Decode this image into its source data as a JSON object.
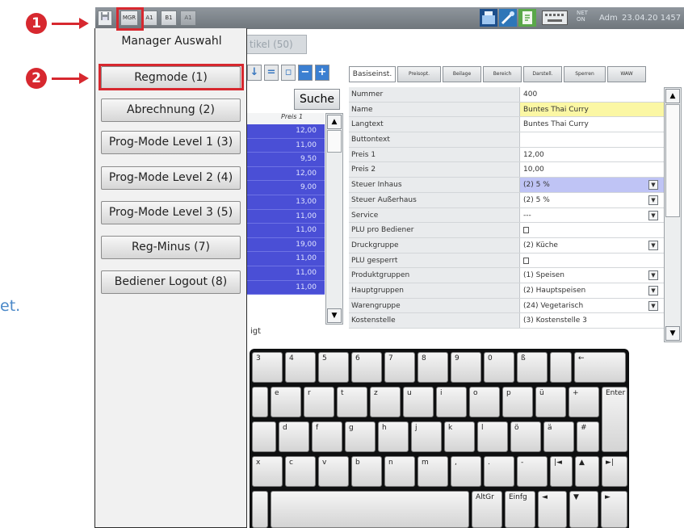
{
  "annotations": {
    "step1": "1",
    "step2": "2",
    "side_text_fragment": "et."
  },
  "topbar": {
    "buttons": [
      "MGR",
      "A1",
      "B1",
      "A1"
    ],
    "net_status": "NET\nON",
    "user": "Adm",
    "datetime": "23.04.20 1457",
    "icons": [
      "floppy-save-icon",
      "cash-register-icon",
      "tools-icon",
      "receipt-icon",
      "keyboard-icon"
    ]
  },
  "manager_panel": {
    "title": "Manager Auswahl",
    "buttons": [
      "Regmode (1)",
      "Abrechnung (2)",
      "Prog-Mode Level 1 (3)",
      "Prog-Mode Level 2 (4)",
      "Prog-Mode Level 3 (5)",
      "Reg-Minus (7)",
      "Bediener Logout (8)"
    ]
  },
  "article_list": {
    "tab_label": "tikel (50)",
    "search_label": "Suche",
    "column_header": "Preis 1",
    "prices": [
      "12,00",
      "11,00",
      "9,50",
      "12,00",
      "9,00",
      "13,00",
      "11,00",
      "11,00",
      "19,00",
      "11,00",
      "11,00",
      "11,00"
    ],
    "footer": "igt"
  },
  "detail": {
    "tabs": [
      "Basiseinst.",
      "Preisopt.",
      "Beilage",
      "Bereich",
      "Darstell.",
      "Sperren",
      "WAW"
    ],
    "rows": [
      {
        "label": "Nummer",
        "value": "400"
      },
      {
        "label": "Name",
        "value": "Buntes Thai Curry"
      },
      {
        "label": "Langtext",
        "value": "Buntes Thai Curry"
      },
      {
        "label": "Buttontext",
        "value": ""
      },
      {
        "label": "Preis 1",
        "value": "12,00"
      },
      {
        "label": "Preis 2",
        "value": "10,00"
      },
      {
        "label": "Steuer Inhaus",
        "value": "(2) 5 %"
      },
      {
        "label": "Steuer Außerhaus",
        "value": "(2) 5 %"
      },
      {
        "label": "Service",
        "value": "---"
      },
      {
        "label": "PLU pro Bediener",
        "value": ""
      },
      {
        "label": "Druckgruppe",
        "value": "(2) Küche"
      },
      {
        "label": "PLU gesperrt",
        "value": ""
      },
      {
        "label": "Produktgruppen",
        "value": "(1) Speisen"
      },
      {
        "label": "Hauptgruppen",
        "value": "(2) Hauptspeisen"
      },
      {
        "label": "Warengruppe",
        "value": "(24) Vegetarisch"
      },
      {
        "label": "Kostenstelle",
        "value": "(3) Kostenstelle 3"
      }
    ]
  },
  "keyboard": {
    "row1": [
      "3",
      "4",
      "5",
      "6",
      "7",
      "8",
      "9",
      "0",
      "ß",
      "",
      "←"
    ],
    "row2": [
      "e",
      "r",
      "t",
      "z",
      "u",
      "i",
      "o",
      "p",
      "ü",
      "+",
      "Enter"
    ],
    "row3": [
      "d",
      "f",
      "g",
      "h",
      "j",
      "k",
      "l",
      "ö",
      "ä",
      "#"
    ],
    "row4": [
      "x",
      "c",
      "v",
      "b",
      "n",
      "m",
      ",",
      ".",
      "-",
      "|◄",
      "▲",
      "►|"
    ],
    "row5": [
      "",
      "AltGr",
      "Einfg",
      "◄",
      "▼",
      "►"
    ]
  }
}
